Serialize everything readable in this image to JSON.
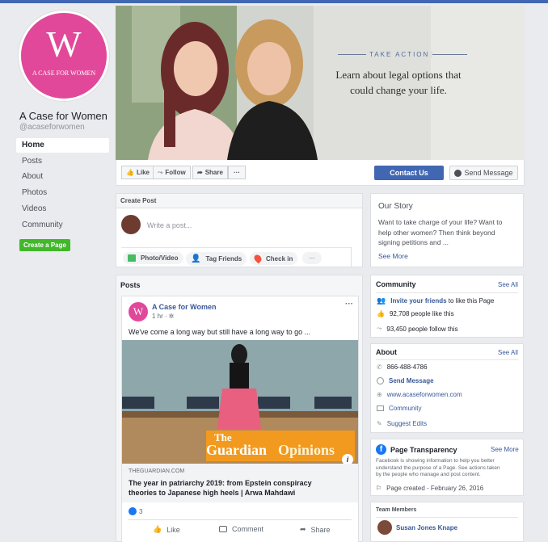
{
  "page": {
    "name": "A Case for Women",
    "handle": "@acaseforwomen",
    "logo_letter": "W",
    "logo_text": "A CASE FOR WOMEN"
  },
  "nav": [
    "Home",
    "Posts",
    "About",
    "Photos",
    "Videos",
    "Community"
  ],
  "create_page": "Create a Page",
  "cover": {
    "eyebrow": "TAKE ACTION",
    "line1": "Learn about legal options that",
    "line2": "could change your life."
  },
  "actions": {
    "like": "Like",
    "follow": "Follow",
    "share": "Share",
    "more": "···",
    "contact": "Contact Us",
    "send_message": "Send Message"
  },
  "create_post": {
    "title": "Create Post",
    "placeholder": "Write a post...",
    "photo_video": "Photo/Video",
    "tag_friends": "Tag Friends",
    "check_in": "Check in",
    "more": "···"
  },
  "posts": {
    "title": "Posts",
    "author": "A Case for Women",
    "time": "1 hr · ",
    "more": "···",
    "text": "We've come a long way but still have a long way to go ...",
    "link_domain": "THEGUARDIAN.COM",
    "link_title_1": "The year in patriarchy 2019: from Epstein conspiracy",
    "link_title_2": "theories to Japanese high heels | Arwa Mahdawi",
    "brand_1": "The",
    "brand_2": "Guardian",
    "brand_3": "Opinions",
    "reactions": "3",
    "like": "Like",
    "comment": "Comment",
    "share": "Share"
  },
  "our_story": {
    "title": "Our Story",
    "line1": "Want to take charge of your life? Want to",
    "line2": "help other women? Then think beyond",
    "line3": "signing petitions and ...",
    "see_more": "See More"
  },
  "community": {
    "title": "Community",
    "see_all": "See All",
    "invite_link": "Invite your friends",
    "invite_rest": " to like this Page",
    "likes": "92,708 people like this",
    "follows": "93,450 people follow this"
  },
  "about": {
    "title": "About",
    "see_all": "See All",
    "phone": "866-488-4786",
    "send_message": "Send Message",
    "website": "www.acaseforwomen.com",
    "category": "Community",
    "suggest": "Suggest Edits"
  },
  "transparency": {
    "title": "Page Transparency",
    "see_more": "See More",
    "line1": "Facebook is showing information to help you better",
    "line2": "understand the purpose of a Page. See actions taken",
    "line3": "by the people who manage and post content.",
    "created": "Page created - February 26, 2016"
  },
  "team": {
    "title": "Team Members",
    "member": "Susan Jones Knape"
  },
  "colors": {
    "fb_blue": "#4267b2",
    "brand_pink": "#e2489a",
    "guardian_orange": "#f29a1f"
  }
}
